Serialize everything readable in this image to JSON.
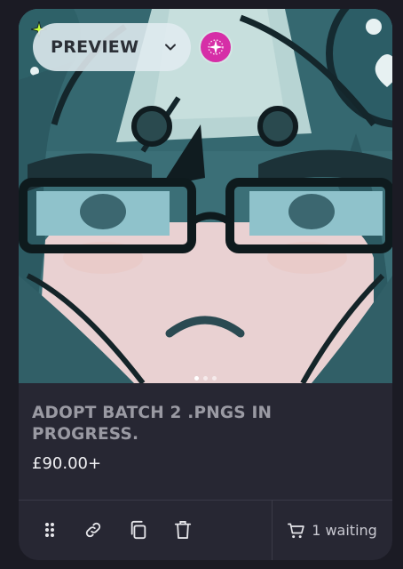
{
  "listing": {
    "preview_label": "PREVIEW",
    "title": "ADOPT BATCH 2 .PNGS IN PROGRESS.",
    "price": "£90.00+",
    "waiting_text": "1 waiting",
    "carousel": {
      "count": 3,
      "active_index": 0
    }
  },
  "icons": {
    "sparkle": "sparkle-icon",
    "chevron": "chevron-down-icon",
    "badge": "star-badge-icon",
    "drag": "drag-handle-icon",
    "link": "link-icon",
    "copy": "copy-icon",
    "delete": "trash-icon",
    "cart": "cart-icon"
  },
  "colors": {
    "card_bg": "#272733",
    "page_bg": "#1b1b24",
    "badge": "#d62ea7",
    "sparkle": "#c6ff3a",
    "title_text": "#9a9aa3",
    "price_text": "#f1f1f4",
    "art_teal": "#3a6d74",
    "art_skin": "#ead3d3"
  }
}
